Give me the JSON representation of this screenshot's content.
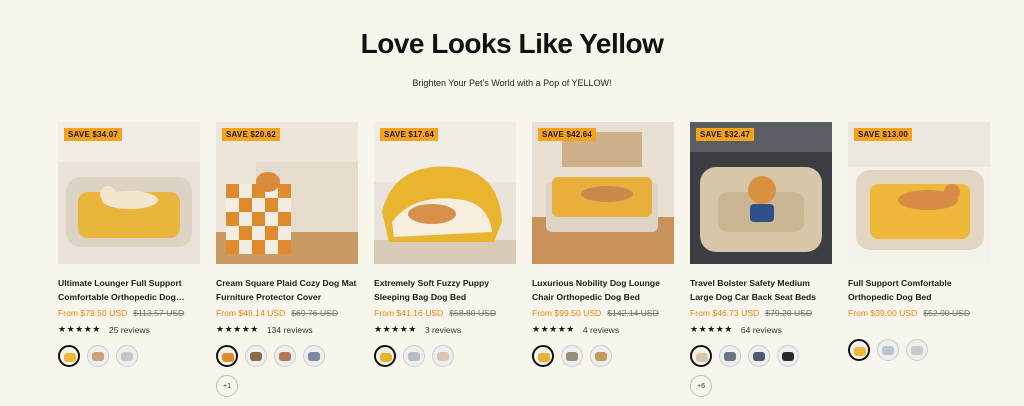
{
  "header": {
    "title": "Love Looks Like Yellow",
    "subtitle": "Brighten Your Pet’s World with a Pop of YELLOW!"
  },
  "products": [
    {
      "save": "SAVE $34.07",
      "name": "Ultimate Lounger Full Support Comfortable Orthopedic Dog…",
      "price_now": "From $79.50 USD",
      "price_was": "$113.57 USD",
      "stars": "★★★★★",
      "reviews": "25 reviews",
      "swatch_colors": [
        "#f0b83a",
        "#c9a37a",
        "#c7c7c7"
      ],
      "more": ""
    },
    {
      "save": "SAVE $20.62",
      "name": "Cream Square Plaid Cozy Dog Mat Furniture Protector Cover",
      "price_now": "From $49.14 USD",
      "price_was": "$69.76 USD",
      "stars": "★★★★★",
      "reviews": "134 reviews",
      "swatch_colors": [
        "#e08a2e",
        "#8a6a4a",
        "#b07a5a",
        "#7a8aa0"
      ],
      "more": "+1"
    },
    {
      "save": "SAVE $17.64",
      "name": "Extremely Soft Fuzzy Puppy Sleeping Bag Dog Bed",
      "price_now": "From $41.16 USD",
      "price_was": "$58.80 USD",
      "stars": "★★★★★",
      "reviews": "3 reviews",
      "swatch_colors": [
        "#e9b52f",
        "#b9bcc4",
        "#d9c7b4"
      ],
      "more": ""
    },
    {
      "save": "SAVE $42.64",
      "name": "Luxurious Nobility Dog Lounge Chair Orthopedic Dog Bed",
      "price_now": "From $99.50 USD",
      "price_was": "$142.14 USD",
      "stars": "★★★★★",
      "reviews": "4 reviews",
      "swatch_colors": [
        "#e8b03a",
        "#9a8a7a",
        "#c29a5a"
      ],
      "more": ""
    },
    {
      "save": "SAVE $32.47",
      "name": "Travel Bolster Safety Medium Large Dog Car Back Seat Beds",
      "price_now": "From $46.73 USD",
      "price_was": "$79.20 USD",
      "stars": "★★★★★",
      "reviews": "64 reviews",
      "swatch_colors": [
        "#d7c7a8",
        "#6a7380",
        "#4a5a6a",
        "#2a2a2a"
      ],
      "more": "+6"
    },
    {
      "save": "SAVE $13.00",
      "name": "Full Support Comfortable Orthopedic Dog Bed",
      "price_now": "From $39.00 USD",
      "price_was": "$52.00 USD",
      "stars": "",
      "reviews": "",
      "swatch_colors": [
        "#f0b83a",
        "#b8c4d2",
        "#c9c9c9"
      ],
      "more": ""
    }
  ],
  "colors": {
    "accent": "#f7a21b",
    "sale_price": "#e8830f",
    "background": "#f8f6ec"
  }
}
